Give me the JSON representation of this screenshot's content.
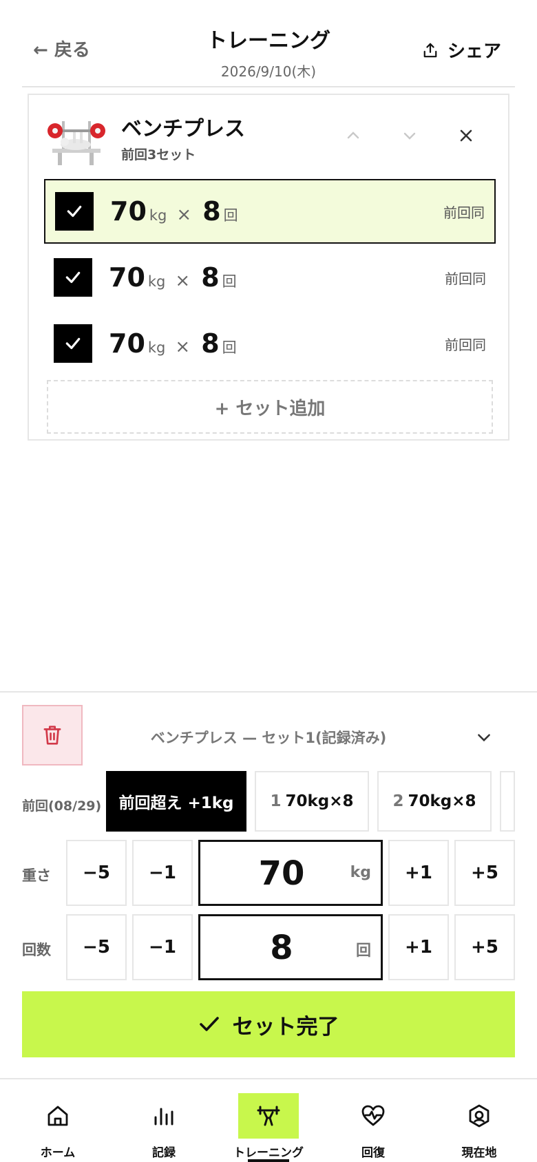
{
  "header": {
    "back_label": "← 戻る",
    "title": "トレーニング",
    "date": "2026/9/10(木)",
    "share_label": "シェア"
  },
  "exercise": {
    "name": "ベンチプレス",
    "previous_summary": "前回3セット",
    "image_icon": "bench-press-icon",
    "sets": [
      {
        "weight": "70",
        "weight_unit": "kg",
        "times": "×",
        "reps": "8",
        "reps_unit": "回",
        "compare": "前回同",
        "checked": true,
        "active": true
      },
      {
        "weight": "70",
        "weight_unit": "kg",
        "times": "×",
        "reps": "8",
        "reps_unit": "回",
        "compare": "前回同",
        "checked": true,
        "active": false
      },
      {
        "weight": "70",
        "weight_unit": "kg",
        "times": "×",
        "reps": "8",
        "reps_unit": "回",
        "compare": "前回同",
        "checked": true,
        "active": false
      }
    ],
    "add_set_label": "+ セット追加"
  },
  "editor": {
    "title": "ベンチプレス — セット1(記録済み)",
    "previous_label": "前回(08/29)",
    "chips": [
      {
        "label": "前回超え +1kg",
        "index": ""
      },
      {
        "label": "70kg×8",
        "index": "1"
      },
      {
        "label": "70kg×8",
        "index": "2"
      }
    ],
    "weight": {
      "label": "重さ",
      "value": "70",
      "unit": "kg",
      "steps": [
        "−5",
        "−1",
        "+1",
        "+5"
      ]
    },
    "reps": {
      "label": "回数",
      "value": "8",
      "unit": "回",
      "steps": [
        "−5",
        "−1",
        "+1",
        "+5"
      ]
    },
    "complete_label": "セット完了"
  },
  "nav": {
    "items": [
      {
        "label": "ホーム",
        "icon": "home-icon"
      },
      {
        "label": "記録",
        "icon": "bar-chart-icon"
      },
      {
        "label": "トレーニング",
        "icon": "barbell-icon"
      },
      {
        "label": "回復",
        "icon": "heart-pulse-icon"
      },
      {
        "label": "現在地",
        "icon": "location-icon"
      }
    ],
    "active_index": 2
  },
  "colors": {
    "accent": "#c8f74c",
    "active_row_bg": "#f3fbdb",
    "delete_bg": "#fbe7ea"
  }
}
